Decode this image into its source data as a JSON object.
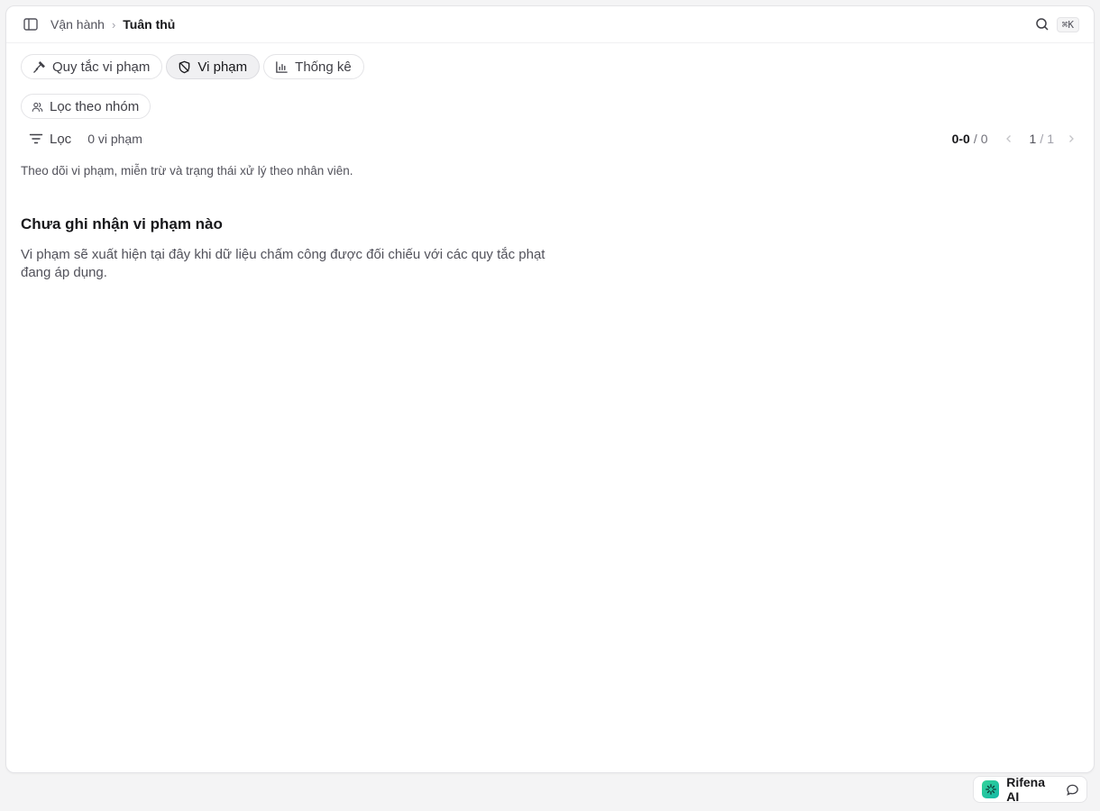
{
  "breadcrumb": {
    "parent": "Vận hành",
    "separator": "›",
    "current": "Tuân thủ"
  },
  "search": {
    "shortcut": "⌘K"
  },
  "tabs": [
    {
      "label": "Quy tắc vi phạm",
      "icon": "gavel-icon"
    },
    {
      "label": "Vi phạm",
      "icon": "shield-icon",
      "active": true
    },
    {
      "label": "Thống kê",
      "icon": "bar-chart-icon"
    }
  ],
  "group_filter": {
    "label": "Lọc theo nhóm",
    "icon": "users-icon"
  },
  "filter": {
    "label": "Lọc",
    "count_text": "0 vi phạm"
  },
  "pagination": {
    "range": "0-0",
    "separator": "/",
    "total": "0",
    "page_current": "1",
    "page_sep": "/",
    "page_total": "1"
  },
  "description": "Theo dõi vi phạm, miễn trừ và trạng thái xử lý theo nhân viên.",
  "empty_state": {
    "title": "Chưa ghi nhận vi phạm nào",
    "body": "Vi phạm sẽ xuất hiện tại đây khi dữ liệu chấm công được đối chiếu với các quy tắc phạt đang áp dụng."
  },
  "assistant": {
    "label": "Rifena AI"
  },
  "colors": {
    "accent": "#14b8a6",
    "text": "#18181b",
    "muted": "#52525b",
    "border": "#e4e4e7"
  }
}
